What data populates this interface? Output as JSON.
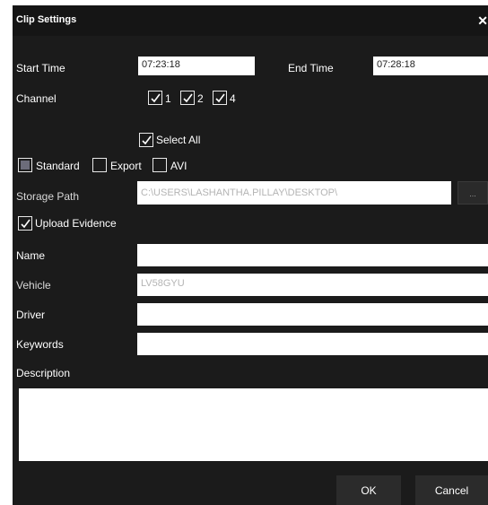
{
  "dialog": {
    "title": "Clip Settings",
    "close_glyph": "✕"
  },
  "time": {
    "start_label": "Start Time",
    "start_value": "07:23:18",
    "end_label": "End Time",
    "end_value": "07:28:18"
  },
  "channel": {
    "label": "Channel",
    "options": [
      {
        "label": "1",
        "checked": true
      },
      {
        "label": "2",
        "checked": true
      },
      {
        "label": "4",
        "checked": true
      }
    ],
    "select_all_label": "Select All",
    "select_all_checked": true
  },
  "format": {
    "standard_label": "Standard",
    "export_label": "Export",
    "avi_label": "AVI"
  },
  "storage": {
    "label": "Storage Path",
    "value": "C:\\USERS\\LASHANTHA.PILLAY\\DESKTOP\\",
    "browse_label": "..."
  },
  "upload": {
    "label": "Upload Evidence",
    "checked": true
  },
  "fields": {
    "name_label": "Name",
    "name_value": "",
    "vehicle_label": "Vehicle",
    "vehicle_placeholder": "LV58GYU",
    "driver_label": "Driver",
    "driver_value": "",
    "keywords_label": "Keywords",
    "keywords_value": "",
    "description_label": "Description",
    "description_value": ""
  },
  "buttons": {
    "ok": "OK",
    "cancel": "Cancel"
  },
  "colors": {
    "dialog_bg": "#1b1b1b",
    "title_bg": "#151515",
    "standard_fill": "#6c6c7a"
  },
  "icons": {
    "close": "close-icon",
    "check": "checkmark-icon"
  }
}
